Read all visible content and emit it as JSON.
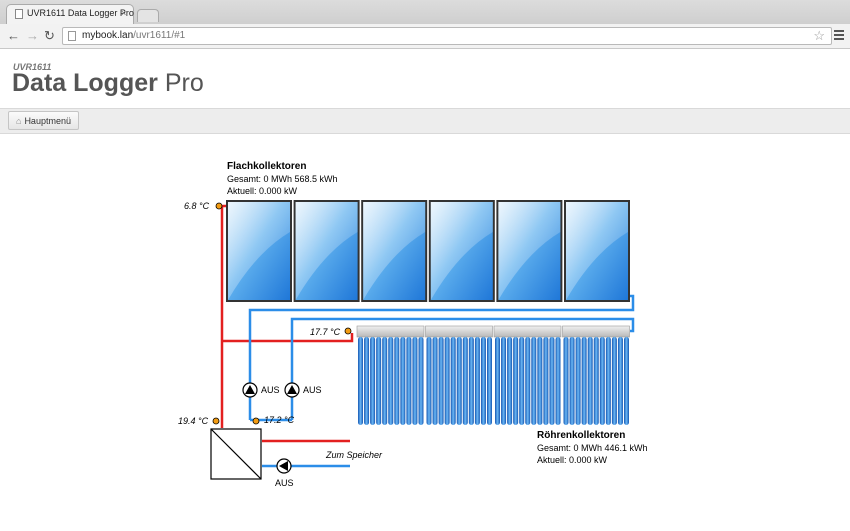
{
  "browser": {
    "tab_title": "UVR1611 Data Logger Pro",
    "tab_close": "×",
    "url_host": "mybook.lan",
    "url_path": "/uvr1611/#1"
  },
  "app": {
    "brand_small": "UVR1611",
    "brand_bold": "Data Logger",
    "brand_light": "Pro",
    "main_menu_label": "Hauptmenü"
  },
  "diagram": {
    "flat_collectors": {
      "title": "Flachkollektoren",
      "total": "Gesamt: 0 MWh 568.5 kWh",
      "current": "Aktuell: 0.000 kW"
    },
    "tube_collectors": {
      "title": "Röhrenkollektoren",
      "total": "Gesamt: 0 MWh 446.1 kWh",
      "current": "Aktuell: 0.000 kW"
    },
    "temps": {
      "flat_out": "6.8 °C",
      "tube_out": "17.7 °C",
      "supply": "19.4 °C",
      "return": "17.2 °C"
    },
    "pumps": {
      "pump1": "AUS",
      "pump2": "AUS",
      "pump3": "AUS"
    },
    "storage_label": "Zum Speicher",
    "colors": {
      "hot": "#e32020",
      "cold": "#2b8de8",
      "sensor": "#f39c12"
    }
  }
}
